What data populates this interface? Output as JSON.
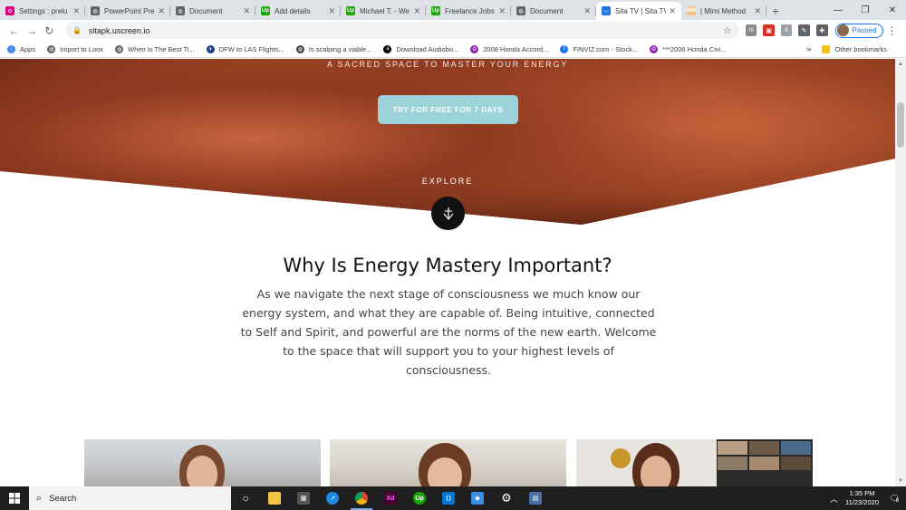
{
  "browser": {
    "tabs": [
      {
        "title": "Settings : prelu",
        "favicon_color": "#e4007c",
        "glyph": "⚙"
      },
      {
        "title": "PowerPoint Pre",
        "favicon_color": "#5f6368",
        "glyph": "◍"
      },
      {
        "title": "Document",
        "favicon_color": "#5f6368",
        "glyph": "◍"
      },
      {
        "title": "Add details",
        "favicon_color": "#14a800",
        "glyph": "Up"
      },
      {
        "title": "Michael T. - We",
        "favicon_color": "#14a800",
        "glyph": "Up"
      },
      {
        "title": "Freelance Jobs",
        "favicon_color": "#14a800",
        "glyph": "Up"
      },
      {
        "title": "Document",
        "favicon_color": "#5f6368",
        "glyph": "◍"
      },
      {
        "title": "Sita TV | Sita TV",
        "favicon_color": "#1a73e8",
        "glyph": "▭",
        "active": true
      },
      {
        "title": "| Mimi Method",
        "favicon_color": "#f1c27d",
        "glyph": "MM"
      }
    ],
    "url": "sitapk.uscreen.io",
    "profile_label": "Paused",
    "bookmarks": [
      {
        "label": "Apps",
        "color": "#4285f4",
        "glyph": "⋮"
      },
      {
        "label": "Import to Loox",
        "color": "#5f6368",
        "glyph": "◍"
      },
      {
        "label": "When Is The Best Ti...",
        "color": "#5f6368",
        "glyph": "◍"
      },
      {
        "label": "DFW to LAS Flights...",
        "color": "#1b3a8a",
        "glyph": "✈"
      },
      {
        "label": "Is scalping a viable...",
        "color": "#444",
        "glyph": "◍"
      },
      {
        "label": "Download Audiobo...",
        "color": "#000",
        "glyph": "a"
      },
      {
        "label": "2008 Honda Accord...",
        "color": "#8e24aa",
        "glyph": "☮"
      },
      {
        "label": "FINVIZ.com - Stock...",
        "color": "#1877f2",
        "glyph": "f"
      },
      {
        "label": "***2006 Honda Civi...",
        "color": "#8e24aa",
        "glyph": "☮"
      }
    ],
    "bookmarks_more": "»",
    "other_bookmarks": "Other bookmarks"
  },
  "page": {
    "hero_tagline": "A SACRED SPACE TO MASTER YOUR ENERGY",
    "cta_label": "TRY FOR FREE FOR 7 DAYS",
    "explore_label": "EXPLORE",
    "section_title": "Why Is Energy Mastery Important?",
    "section_body": "As we navigate the next stage of consciousness we much know our energy system, and what they are capable of. Being intuitive, connected to Self and Spirit, and powerful are the norms of the new earth. Welcome to the space that will support you to your highest levels of consciousness."
  },
  "taskbar": {
    "search_label": "Search",
    "time": "1:35 PM",
    "date": "11/23/2020",
    "notification_count": "6"
  }
}
